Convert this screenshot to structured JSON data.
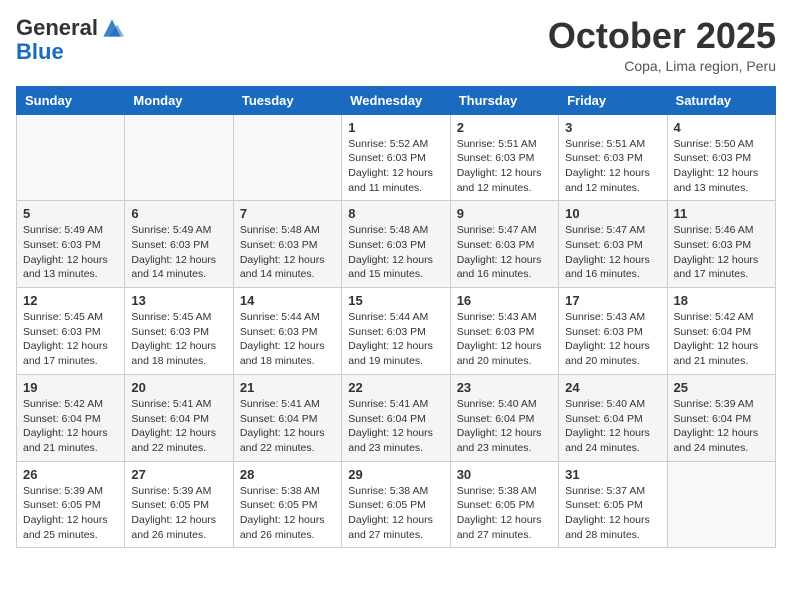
{
  "header": {
    "logo_general": "General",
    "logo_blue": "Blue",
    "month_title": "October 2025",
    "location": "Copa, Lima region, Peru"
  },
  "days_of_week": [
    "Sunday",
    "Monday",
    "Tuesday",
    "Wednesday",
    "Thursday",
    "Friday",
    "Saturday"
  ],
  "weeks": [
    [
      {
        "day": "",
        "sunrise": "",
        "sunset": "",
        "daylight": ""
      },
      {
        "day": "",
        "sunrise": "",
        "sunset": "",
        "daylight": ""
      },
      {
        "day": "",
        "sunrise": "",
        "sunset": "",
        "daylight": ""
      },
      {
        "day": "1",
        "sunrise": "Sunrise: 5:52 AM",
        "sunset": "Sunset: 6:03 PM",
        "daylight": "Daylight: 12 hours and 11 minutes."
      },
      {
        "day": "2",
        "sunrise": "Sunrise: 5:51 AM",
        "sunset": "Sunset: 6:03 PM",
        "daylight": "Daylight: 12 hours and 12 minutes."
      },
      {
        "day": "3",
        "sunrise": "Sunrise: 5:51 AM",
        "sunset": "Sunset: 6:03 PM",
        "daylight": "Daylight: 12 hours and 12 minutes."
      },
      {
        "day": "4",
        "sunrise": "Sunrise: 5:50 AM",
        "sunset": "Sunset: 6:03 PM",
        "daylight": "Daylight: 12 hours and 13 minutes."
      }
    ],
    [
      {
        "day": "5",
        "sunrise": "Sunrise: 5:49 AM",
        "sunset": "Sunset: 6:03 PM",
        "daylight": "Daylight: 12 hours and 13 minutes."
      },
      {
        "day": "6",
        "sunrise": "Sunrise: 5:49 AM",
        "sunset": "Sunset: 6:03 PM",
        "daylight": "Daylight: 12 hours and 14 minutes."
      },
      {
        "day": "7",
        "sunrise": "Sunrise: 5:48 AM",
        "sunset": "Sunset: 6:03 PM",
        "daylight": "Daylight: 12 hours and 14 minutes."
      },
      {
        "day": "8",
        "sunrise": "Sunrise: 5:48 AM",
        "sunset": "Sunset: 6:03 PM",
        "daylight": "Daylight: 12 hours and 15 minutes."
      },
      {
        "day": "9",
        "sunrise": "Sunrise: 5:47 AM",
        "sunset": "Sunset: 6:03 PM",
        "daylight": "Daylight: 12 hours and 16 minutes."
      },
      {
        "day": "10",
        "sunrise": "Sunrise: 5:47 AM",
        "sunset": "Sunset: 6:03 PM",
        "daylight": "Daylight: 12 hours and 16 minutes."
      },
      {
        "day": "11",
        "sunrise": "Sunrise: 5:46 AM",
        "sunset": "Sunset: 6:03 PM",
        "daylight": "Daylight: 12 hours and 17 minutes."
      }
    ],
    [
      {
        "day": "12",
        "sunrise": "Sunrise: 5:45 AM",
        "sunset": "Sunset: 6:03 PM",
        "daylight": "Daylight: 12 hours and 17 minutes."
      },
      {
        "day": "13",
        "sunrise": "Sunrise: 5:45 AM",
        "sunset": "Sunset: 6:03 PM",
        "daylight": "Daylight: 12 hours and 18 minutes."
      },
      {
        "day": "14",
        "sunrise": "Sunrise: 5:44 AM",
        "sunset": "Sunset: 6:03 PM",
        "daylight": "Daylight: 12 hours and 18 minutes."
      },
      {
        "day": "15",
        "sunrise": "Sunrise: 5:44 AM",
        "sunset": "Sunset: 6:03 PM",
        "daylight": "Daylight: 12 hours and 19 minutes."
      },
      {
        "day": "16",
        "sunrise": "Sunrise: 5:43 AM",
        "sunset": "Sunset: 6:03 PM",
        "daylight": "Daylight: 12 hours and 20 minutes."
      },
      {
        "day": "17",
        "sunrise": "Sunrise: 5:43 AM",
        "sunset": "Sunset: 6:03 PM",
        "daylight": "Daylight: 12 hours and 20 minutes."
      },
      {
        "day": "18",
        "sunrise": "Sunrise: 5:42 AM",
        "sunset": "Sunset: 6:04 PM",
        "daylight": "Daylight: 12 hours and 21 minutes."
      }
    ],
    [
      {
        "day": "19",
        "sunrise": "Sunrise: 5:42 AM",
        "sunset": "Sunset: 6:04 PM",
        "daylight": "Daylight: 12 hours and 21 minutes."
      },
      {
        "day": "20",
        "sunrise": "Sunrise: 5:41 AM",
        "sunset": "Sunset: 6:04 PM",
        "daylight": "Daylight: 12 hours and 22 minutes."
      },
      {
        "day": "21",
        "sunrise": "Sunrise: 5:41 AM",
        "sunset": "Sunset: 6:04 PM",
        "daylight": "Daylight: 12 hours and 22 minutes."
      },
      {
        "day": "22",
        "sunrise": "Sunrise: 5:41 AM",
        "sunset": "Sunset: 6:04 PM",
        "daylight": "Daylight: 12 hours and 23 minutes."
      },
      {
        "day": "23",
        "sunrise": "Sunrise: 5:40 AM",
        "sunset": "Sunset: 6:04 PM",
        "daylight": "Daylight: 12 hours and 23 minutes."
      },
      {
        "day": "24",
        "sunrise": "Sunrise: 5:40 AM",
        "sunset": "Sunset: 6:04 PM",
        "daylight": "Daylight: 12 hours and 24 minutes."
      },
      {
        "day": "25",
        "sunrise": "Sunrise: 5:39 AM",
        "sunset": "Sunset: 6:04 PM",
        "daylight": "Daylight: 12 hours and 24 minutes."
      }
    ],
    [
      {
        "day": "26",
        "sunrise": "Sunrise: 5:39 AM",
        "sunset": "Sunset: 6:05 PM",
        "daylight": "Daylight: 12 hours and 25 minutes."
      },
      {
        "day": "27",
        "sunrise": "Sunrise: 5:39 AM",
        "sunset": "Sunset: 6:05 PM",
        "daylight": "Daylight: 12 hours and 26 minutes."
      },
      {
        "day": "28",
        "sunrise": "Sunrise: 5:38 AM",
        "sunset": "Sunset: 6:05 PM",
        "daylight": "Daylight: 12 hours and 26 minutes."
      },
      {
        "day": "29",
        "sunrise": "Sunrise: 5:38 AM",
        "sunset": "Sunset: 6:05 PM",
        "daylight": "Daylight: 12 hours and 27 minutes."
      },
      {
        "day": "30",
        "sunrise": "Sunrise: 5:38 AM",
        "sunset": "Sunset: 6:05 PM",
        "daylight": "Daylight: 12 hours and 27 minutes."
      },
      {
        "day": "31",
        "sunrise": "Sunrise: 5:37 AM",
        "sunset": "Sunset: 6:05 PM",
        "daylight": "Daylight: 12 hours and 28 minutes."
      },
      {
        "day": "",
        "sunrise": "",
        "sunset": "",
        "daylight": ""
      }
    ]
  ]
}
